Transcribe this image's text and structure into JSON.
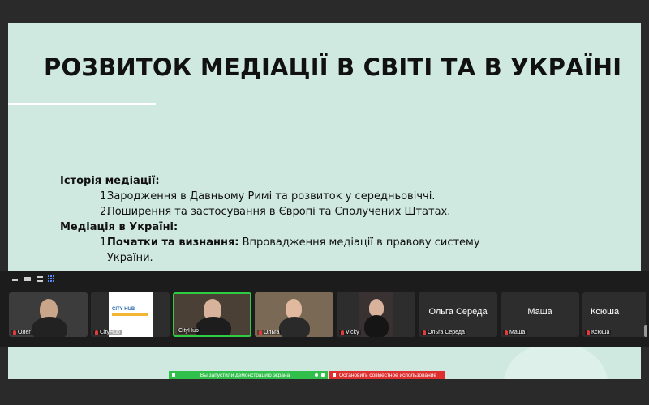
{
  "slide": {
    "title": "РОЗВИТОК МЕДІАЦІЇ В СВІТІ ТА В УКРАЇНІ",
    "sections": [
      {
        "heading": "Історія медіації:",
        "items": [
          {
            "num": "1.",
            "text": "Зародження в Давньому Римі та розвиток у середньовіччі."
          },
          {
            "num": "2.",
            "text": "Поширення та застосування в Європі та Сполучених Штатах."
          }
        ]
      },
      {
        "heading": "Медіація в Україні:",
        "items": [
          {
            "num": "1.",
            "bold": "Початки та визнання:",
            "text": " Впровадження медіації в правову систему України."
          }
        ]
      }
    ]
  },
  "participants": [
    {
      "name": "Олег",
      "type": "video",
      "bg": "#3c3c3c",
      "muted": true
    },
    {
      "name": "CityHub",
      "type": "logo",
      "logo_text": "CITY HUB",
      "muted": true
    },
    {
      "name": "CityHub",
      "type": "video",
      "bg": "#4a4036",
      "active": true,
      "muted": false
    },
    {
      "name": "Ольга",
      "type": "video",
      "bg": "#7a6a55",
      "muted": true
    },
    {
      "name": "Vicky",
      "type": "video",
      "bg": "#3a3232",
      "muted": true
    },
    {
      "name": "Ольга Середа",
      "type": "name",
      "muted": true
    },
    {
      "name": "Маша",
      "type": "name",
      "muted": true
    },
    {
      "name": "Ксюша",
      "type": "name",
      "muted": true
    }
  ],
  "share_bar": {
    "status": "Вы запустили демонстрацию экрана",
    "stop": "Остановить совместное использование"
  },
  "colors": {
    "slide_bg": "#cfe9e1",
    "active_border": "#2ecc40",
    "share_green": "#2fbf4a",
    "share_red": "#e02f2f"
  }
}
